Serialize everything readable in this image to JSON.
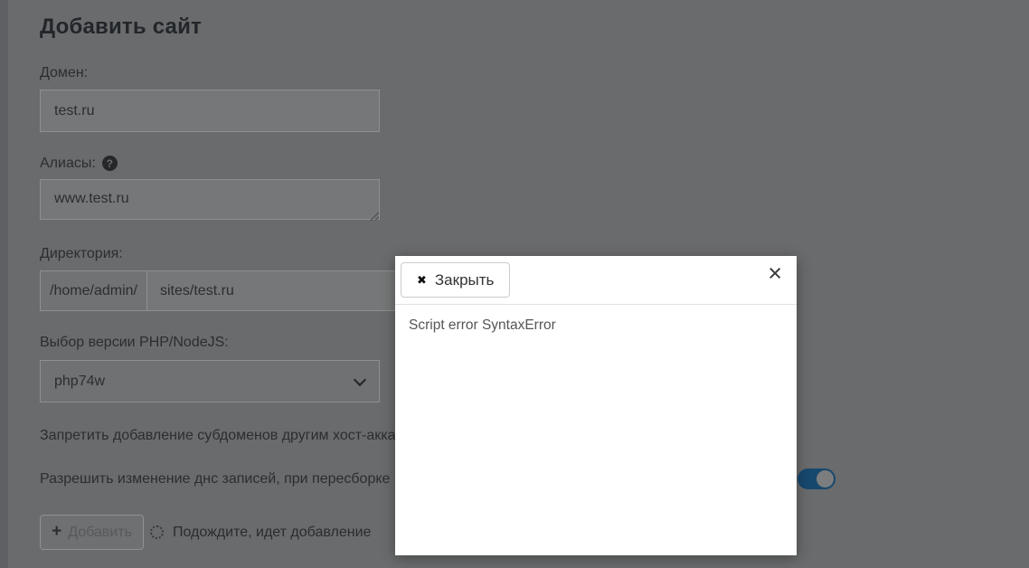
{
  "page": {
    "title": "Добавить сайт"
  },
  "form": {
    "domain": {
      "label": "Домен:",
      "value": "test.ru"
    },
    "aliases": {
      "label": "Алиасы:",
      "value": "www.test.ru",
      "help_icon": "question-circle-icon"
    },
    "directory": {
      "label": "Директория:",
      "prefix": "/home/admin/",
      "value": "sites/test.ru"
    },
    "php_version": {
      "label": "Выбор версии PHP/NodeJS:",
      "selected": "php74w"
    },
    "options": [
      {
        "label": "Запретить добавление субдоменов другим хост-акка"
      },
      {
        "label": "Разрешить изменение днс записей, при пересборке",
        "toggle_state": "on"
      }
    ],
    "submit_label": "Добавить",
    "progress_text": "Подождите, идет добавление"
  },
  "modal": {
    "close_label": "Закрыть",
    "close_glyph": "✖",
    "corner_glyph": "×",
    "body_text": "Script error SyntaxError"
  },
  "colors": {
    "backdrop_background": "#6a6b6c",
    "toggle_on": "#17486e",
    "modal_background": "#ffffff",
    "modal_divider": "#e2e2e2",
    "text_primary": "#2c2d2e"
  }
}
